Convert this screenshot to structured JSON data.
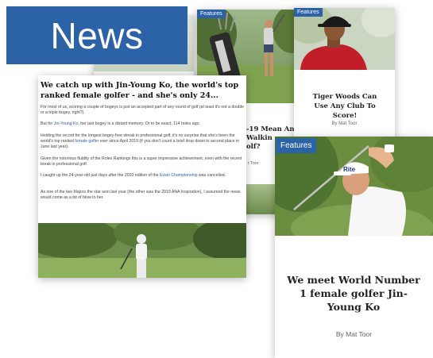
{
  "banner": {
    "title": "News"
  },
  "cards": {
    "top_left": {
      "badge": ""
    },
    "top_middle": {
      "badge": "Features",
      "title_fragment_1": "-19 Mean An",
      "title_fragment_2": "Walkin",
      "title_fragment_3": "olf?",
      "author_fragment": "t Toor"
    },
    "top_right": {
      "badge": "Features",
      "title": "Tiger Woods Can Use Any Club To Score!",
      "author": "By Mat Toor"
    },
    "feature": {
      "badge": "Features",
      "title": "We meet World Number 1 female golfer Jin-Young Ko",
      "author": "By Mat Toor"
    }
  },
  "article": {
    "title": "We catch up with Jin-Young Ko, the world's top ranked female golfer - and she's only 24...",
    "p1": "For most of us, scoring a couple of bogeys is just an accepted part of any round of golf (at least it's not a double or a triple bogey, right?).",
    "p2_pre": "But for ",
    "p2_link": "Jin-Young Ko",
    "p2_post": ", her last bogey is a distant memory. Or to be exact, 114 holes ago.",
    "p3_pre": "Holding the record for the longest bogey-free streak in professional golf, it's no surprise that she's been the world's top ranked ",
    "p3_link": "female golfer",
    "p3_post": " ever since April 2019 (if you don't count a brief drop down to second place in June last year).",
    "p4": "Given the notorious fluidity of the Rolex Rankings this is a super impressive achievement, even with the recent break in professional golf.",
    "p5_pre": "I caught up the 24-year-old just days after the 2020 edition of the ",
    "p5_link": "Evian Championship",
    "p5_post": " was cancelled.",
    "p6": "As one of the two Majors the star won last year (the other was the 2019 ANA Inspiration), I assumed the news would come as a bit of blow to her."
  },
  "cap_text": "Rite",
  "colors": {
    "accent": "#2c62a6",
    "link": "#2c62a6"
  }
}
